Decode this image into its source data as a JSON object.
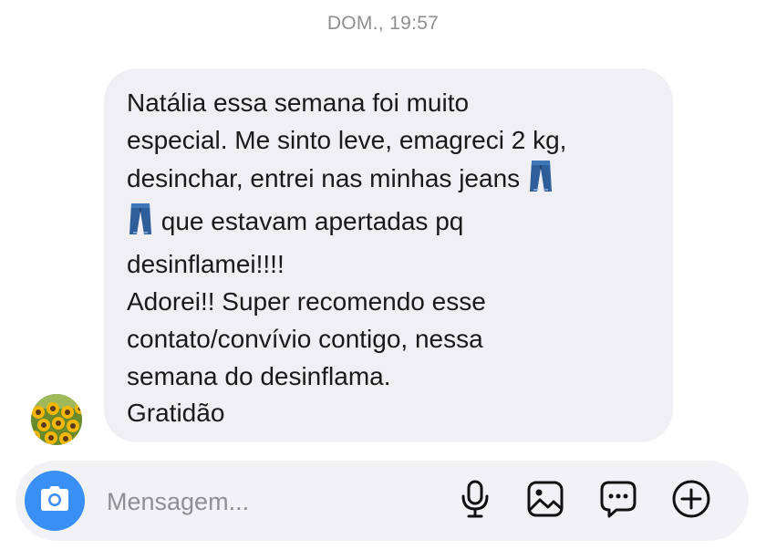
{
  "header": {
    "timestamp": "DOM., 19:57"
  },
  "message": {
    "lines": [
      "Natália essa semana foi muito",
      "especial. Me sinto leve, emagreci 2 kg,",
      "desinchar, entrei nas minhas jeans",
      "que estavam apertadas pq",
      "desinflamei!!!!",
      "Adorei!! Super recomendo esse",
      "contato/convívio contigo,  nessa",
      "semana do desinflama.",
      "Gratidão"
    ],
    "emoji": "jeans-icon"
  },
  "composer": {
    "placeholder": "Mensagem...",
    "icons": [
      "camera-icon",
      "microphone-icon",
      "image-icon",
      "sticker-icon",
      "plus-icon"
    ]
  },
  "colors": {
    "bubble": "#efeff4",
    "composer": "#f2f2f6",
    "camera_button": "#3a8ff5",
    "timestamp": "#8e8e93"
  }
}
